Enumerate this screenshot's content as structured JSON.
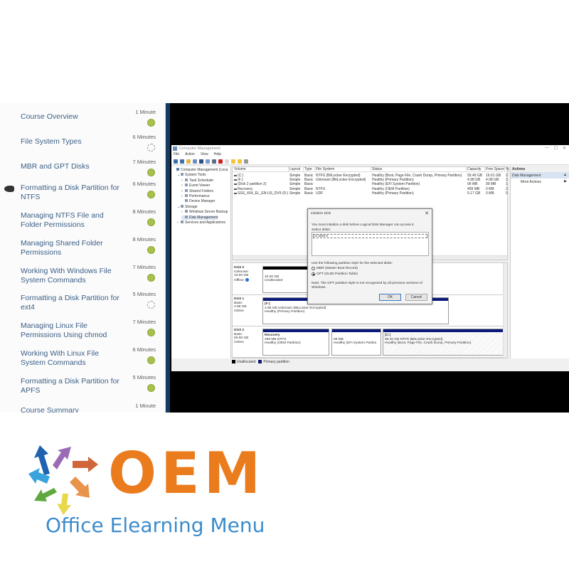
{
  "course_panel": {
    "lessons": [
      {
        "title": "Course Overview",
        "duration": "1 Minute",
        "status": "complete"
      },
      {
        "title": "File System Types",
        "duration": "6 Minutes",
        "status": "incomplete"
      },
      {
        "title": "MBR and GPT Disks",
        "duration": "7 Minutes",
        "status": "complete"
      },
      {
        "title": "Formatting a Disk Partition for NTFS",
        "duration": "6 Minutes",
        "status": "complete",
        "current": true
      },
      {
        "title": "Managing NTFS File and Folder Permissions",
        "duration": "8 Minutes",
        "status": "complete"
      },
      {
        "title": "Managing Shared Folder Permissions",
        "duration": "8 Minutes",
        "status": "complete"
      },
      {
        "title": "Working With Windows File System Commands",
        "duration": "7 Minutes",
        "status": "complete"
      },
      {
        "title": "Formatting a Disk Partition for ext4",
        "duration": "5 Minutes",
        "status": "incomplete"
      },
      {
        "title": "Managing Linux File Permissions Using chmod",
        "duration": "7 Minutes",
        "status": "complete"
      },
      {
        "title": "Working With Linux File System Commands",
        "duration": "6 Minutes",
        "status": "complete"
      },
      {
        "title": "Formatting a Disk Partition for APFS",
        "duration": "5 Minutes",
        "status": "complete"
      },
      {
        "title": "Course Summary",
        "duration": "1 Minute",
        "status": "unknown"
      }
    ],
    "colors": {
      "complete": "#a8c14a",
      "title": "#3b5f86",
      "accent_bar": "#153a60"
    }
  },
  "computer_management": {
    "window_title": "Computer Management",
    "window_controls": {
      "minimize": "—",
      "maximize": "☐",
      "close": "✕"
    },
    "menu": [
      "File",
      "Action",
      "View",
      "Help"
    ],
    "tree": [
      {
        "label": "Computer Management (Loca",
        "level": 0,
        "expander": ""
      },
      {
        "label": "System Tools",
        "level": 1,
        "expander": "⌄"
      },
      {
        "label": "Task Scheduler",
        "level": 2,
        "expander": "›"
      },
      {
        "label": "Event Viewer",
        "level": 2,
        "expander": "›"
      },
      {
        "label": "Shared Folders",
        "level": 2,
        "expander": "›"
      },
      {
        "label": "Performance",
        "level": 2,
        "expander": "›"
      },
      {
        "label": "Device Manager",
        "level": 2,
        "expander": ""
      },
      {
        "label": "Storage",
        "level": 1,
        "expander": "⌄"
      },
      {
        "label": "Windows Server Backup",
        "level": 2,
        "expander": "›"
      },
      {
        "label": "Disk Management",
        "level": 2,
        "expander": "",
        "selected": true
      },
      {
        "label": "Services and Applications",
        "level": 1,
        "expander": "›"
      }
    ],
    "volume_table": {
      "headers": [
        "Volume",
        "Layout",
        "Type",
        "File System",
        "Status",
        "Capacity",
        "Free Space",
        "%"
      ],
      "rows": [
        [
          "(C:)",
          "Simple",
          "Basic",
          "NTFS (BitLocker Encrypted)",
          "Healthy (Boot, Page File, Crash Dump, Primary Partition)",
          "59.49 GB",
          "16.61 GB",
          "2"
        ],
        [
          "(F:)",
          "Simple",
          "Basic",
          "Unknown (BitLocker Encrypted)",
          "Healthy (Primary Partition)",
          "4.98 GB",
          "4.98 GB",
          "1"
        ],
        [
          "(Disk 2 partition 2)",
          "Simple",
          "Basic",
          "",
          "Healthy (EFI System Partition)",
          "99 MB",
          "99 MB",
          "1"
        ],
        [
          "Recovery",
          "Simple",
          "Basic",
          "NTFS",
          "Healthy (OEM Partition)",
          "499 MB",
          "0 MB",
          "2"
        ],
        [
          "SSS_X64_EL_EN-US_DV9 (D:)",
          "Simple",
          "Basic",
          "UDF",
          "Healthy (Primary Partition)",
          "5.17 GB",
          "0 MB",
          "0"
        ]
      ]
    },
    "disks": [
      {
        "name": "Disk 0",
        "type": "Unknown",
        "size": "10.00 GB",
        "state": "Offline",
        "partitions": [
          {
            "label": "",
            "line1": "10.00 GB",
            "line2": "Unallocated",
            "kind": "unallocated"
          }
        ]
      },
      {
        "name": "Disk 1",
        "type": "Basic",
        "size": "4.98 GB",
        "state": "Online",
        "partitions": [
          {
            "label": "(F:)",
            "line1": "4.98 GB Unknown (BitLocker Encrypted)",
            "line2": "Healthy (Primary Partition)",
            "kind": "primary"
          }
        ]
      },
      {
        "name": "Disk 2",
        "type": "Basic",
        "size": "59.98 GB",
        "state": "Online",
        "partitions": [
          {
            "label": "Recovery",
            "line1": "499 MB NTFS",
            "line2": "Healthy (OEM Partition)",
            "kind": "primary"
          },
          {
            "label": "",
            "line1": "99 MB",
            "line2": "Healthy (EFI System Partitio",
            "kind": "primary"
          },
          {
            "label": "(C:)",
            "line1": "59.40 GB NTFS (BitLocker Encrypted)",
            "line2": "Healthy (Boot, Page File, Crash Dump, Primary Partition)",
            "kind": "primary-selected"
          }
        ]
      }
    ],
    "legend": [
      {
        "label": "Unallocated",
        "color": "#000000"
      },
      {
        "label": "Primary partition",
        "color": "#0a1a7a"
      }
    ],
    "actions": {
      "header": "Actions",
      "section": "Disk Management",
      "items": [
        "More Actions"
      ]
    }
  },
  "initialize_disk_dialog": {
    "title": "Initialize Disk",
    "close": "✕",
    "intro": "You must initialize a disk before Logical Disk Manager can access it.",
    "select_label": "Select disks:",
    "disks": [
      {
        "label": "Disk 0",
        "checked": true
      }
    ],
    "style_label": "Use the following partition style for the selected disks:",
    "options": [
      {
        "label": "MBR (Master Boot Record)",
        "selected": false
      },
      {
        "label": "GPT (GUID Partition Table)",
        "selected": true
      }
    ],
    "note": "Note: The GPT partition style is not recognized by all previous versions of",
    "note2": "Windows.",
    "ok": "OK",
    "cancel": "Cancel"
  },
  "brand": {
    "logo_text": "OEM",
    "tagline": "Office Elearning Menu",
    "colors": {
      "logo": "#ea7c1e",
      "tagline": "#3d8ccc"
    }
  }
}
